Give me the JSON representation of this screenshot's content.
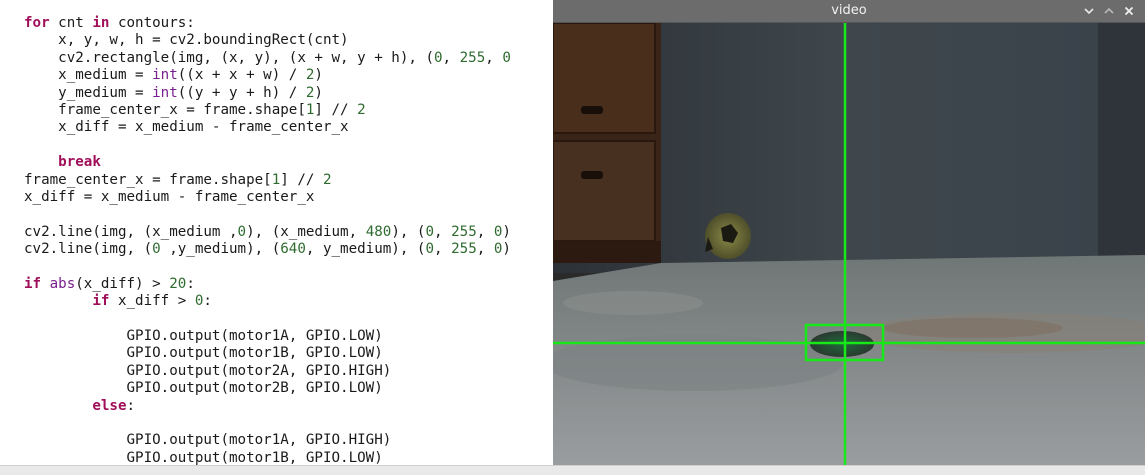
{
  "editor": {
    "lines": [
      [
        {
          "t": "for",
          "c": "kw"
        },
        {
          "t": " cnt "
        },
        {
          "t": "in",
          "c": "kw"
        },
        {
          "t": " contours:"
        }
      ],
      [
        {
          "t": "    x, y, w, h = cv2.boundingRect(cnt)"
        }
      ],
      [
        {
          "t": "    cv2.rectangle(img, (x, y), (x + w, y + h), ("
        },
        {
          "t": "0",
          "c": "num"
        },
        {
          "t": ", "
        },
        {
          "t": "255",
          "c": "num"
        },
        {
          "t": ", "
        },
        {
          "t": "0",
          "c": "num"
        }
      ],
      [
        {
          "t": "    x_medium = "
        },
        {
          "t": "int",
          "c": "bi"
        },
        {
          "t": "((x + x + w) / "
        },
        {
          "t": "2",
          "c": "num"
        },
        {
          "t": ")"
        }
      ],
      [
        {
          "t": "    y_medium = "
        },
        {
          "t": "int",
          "c": "bi"
        },
        {
          "t": "((y + y + h) / "
        },
        {
          "t": "2",
          "c": "num"
        },
        {
          "t": ")"
        }
      ],
      [
        {
          "t": "    frame_center_x = frame.shape["
        },
        {
          "t": "1",
          "c": "num"
        },
        {
          "t": "] // "
        },
        {
          "t": "2",
          "c": "num"
        }
      ],
      [
        {
          "t": "    x_diff = x_medium - frame_center_x"
        }
      ],
      [
        {
          "t": ""
        }
      ],
      [
        {
          "t": "    "
        },
        {
          "t": "break",
          "c": "kw"
        }
      ],
      [
        {
          "t": "frame_center_x = frame.shape["
        },
        {
          "t": "1",
          "c": "num"
        },
        {
          "t": "] // "
        },
        {
          "t": "2",
          "c": "num"
        }
      ],
      [
        {
          "t": "x_diff = x_medium - frame_center_x"
        }
      ],
      [
        {
          "t": ""
        }
      ],
      [
        {
          "t": "cv2.line(img, (x_medium ,"
        },
        {
          "t": "0",
          "c": "num"
        },
        {
          "t": "), (x_medium, "
        },
        {
          "t": "480",
          "c": "num"
        },
        {
          "t": "), ("
        },
        {
          "t": "0",
          "c": "num"
        },
        {
          "t": ", "
        },
        {
          "t": "255",
          "c": "num"
        },
        {
          "t": ", "
        },
        {
          "t": "0",
          "c": "num"
        },
        {
          "t": ")"
        }
      ],
      [
        {
          "t": "cv2.line(img, ("
        },
        {
          "t": "0",
          "c": "num"
        },
        {
          "t": " ,y_medium), ("
        },
        {
          "t": "640",
          "c": "num"
        },
        {
          "t": ", y_medium), ("
        },
        {
          "t": "0",
          "c": "num"
        },
        {
          "t": ", "
        },
        {
          "t": "255",
          "c": "num"
        },
        {
          "t": ", "
        },
        {
          "t": "0",
          "c": "num"
        },
        {
          "t": ")"
        }
      ],
      [
        {
          "t": ""
        }
      ],
      [
        {
          "t": "if",
          "c": "kw"
        },
        {
          "t": " "
        },
        {
          "t": "abs",
          "c": "bi"
        },
        {
          "t": "(x_diff) > "
        },
        {
          "t": "20",
          "c": "num"
        },
        {
          "t": ":"
        }
      ],
      [
        {
          "t": "        "
        },
        {
          "t": "if",
          "c": "kw"
        },
        {
          "t": " x_diff > "
        },
        {
          "t": "0",
          "c": "num"
        },
        {
          "t": ":"
        }
      ],
      [
        {
          "t": ""
        }
      ],
      [
        {
          "t": "            GPIO.output(motor1A, GPIO.LOW)"
        }
      ],
      [
        {
          "t": "            GPIO.output(motor1B, GPIO.LOW)"
        }
      ],
      [
        {
          "t": "            GPIO.output(motor2A, GPIO.HIGH)"
        }
      ],
      [
        {
          "t": "            GPIO.output(motor2B, GPIO.LOW)"
        }
      ],
      [
        {
          "t": "        "
        },
        {
          "t": "else",
          "c": "kw"
        },
        {
          "t": ":"
        }
      ],
      [
        {
          "t": ""
        }
      ],
      [
        {
          "t": "            GPIO.output(motor1A, GPIO.HIGH)"
        }
      ],
      [
        {
          "t": "            GPIO.output(motor1B, GPIO.LOW)"
        }
      ]
    ]
  },
  "video_window": {
    "title": "video",
    "controls": [
      "chevron-down-icon",
      "chevron-up-icon",
      "close-icon"
    ]
  },
  "colors": {
    "titlebar": "#6c6c6c",
    "overlay_green": "#17e817",
    "keyword": "#a00f5a",
    "builtin": "#7a1f8f",
    "number": "#2f6b2f"
  }
}
